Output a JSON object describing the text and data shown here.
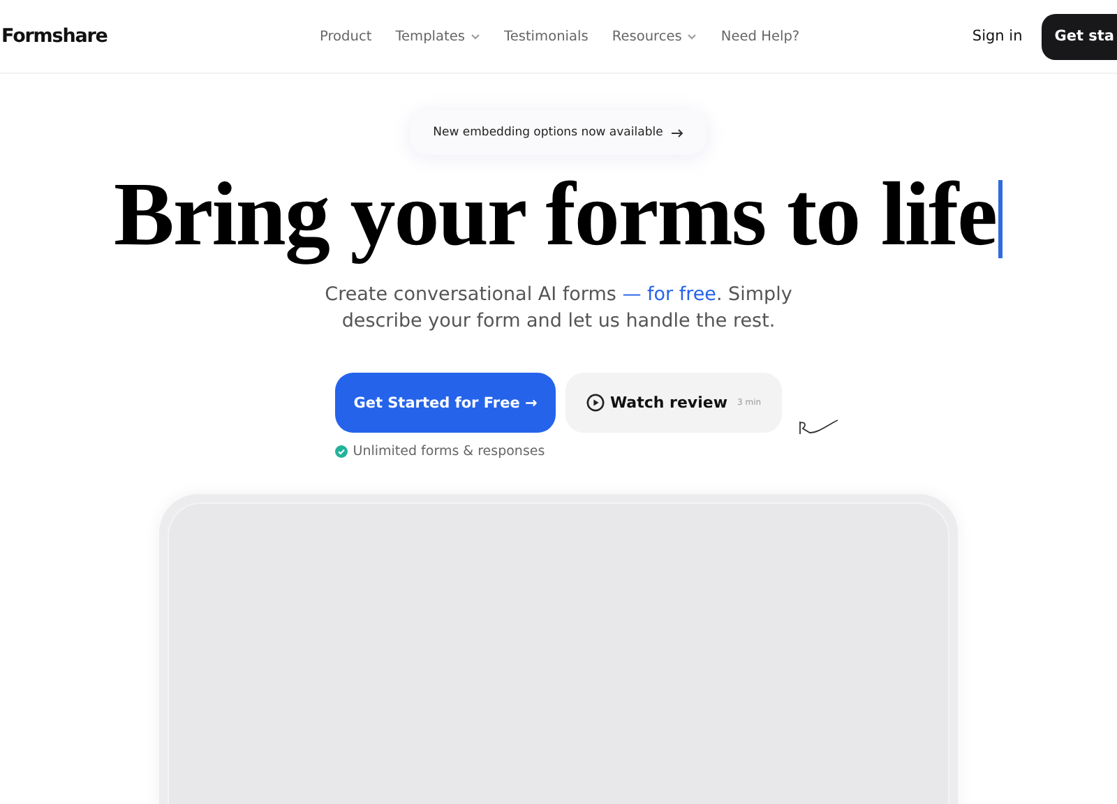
{
  "logo": "Formshare",
  "nav": [
    {
      "label": "Product",
      "has_menu": false
    },
    {
      "label": "Templates",
      "has_menu": true
    },
    {
      "label": "Testimonials",
      "has_menu": false
    },
    {
      "label": "Resources",
      "has_menu": true
    },
    {
      "label": "Need Help?",
      "has_menu": false
    }
  ],
  "sign_in": "Sign in",
  "header_cta": "Get sta",
  "announcement": "New embedding options now available",
  "headline": "Bring your forms to life",
  "subtitle": [
    {
      "text": "Create conversational AI forms ",
      "accent": false
    },
    {
      "text": "— for free",
      "accent": true
    },
    {
      "text": ". Simply describe your form and let us handle the rest.",
      "accent": false
    }
  ],
  "primary_button": "Get Started for Free →",
  "secondary_button": {
    "label": "Watch review",
    "duration": "3 min"
  },
  "note": "Unlimited forms & responses"
}
